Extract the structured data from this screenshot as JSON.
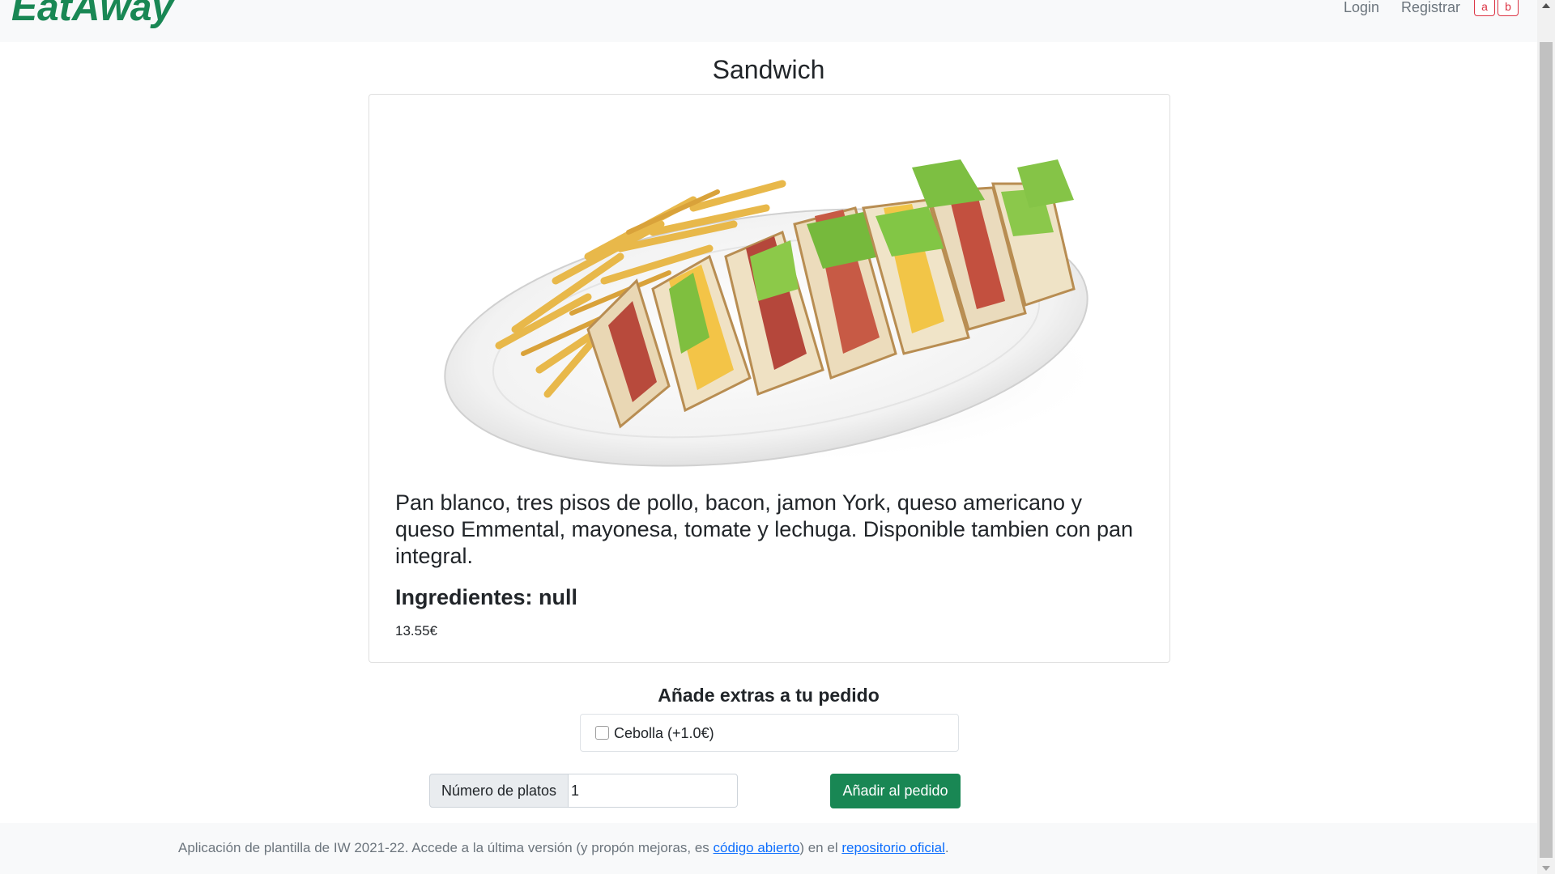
{
  "navbar": {
    "brand": "EatAway",
    "login": "Login",
    "register": "Registrar",
    "btn_a": "a",
    "btn_b": "b"
  },
  "product": {
    "title": "Sandwich",
    "description": "Pan blanco, tres pisos de pollo, bacon, jamon York, queso americano y queso Emmental, mayonesa, tomate y lechuga. Disponible tambien con pan integral.",
    "ingredients": "Ingredientes: null",
    "price": "13.55€"
  },
  "extras": {
    "title": "Añade extras a tu pedido",
    "items": [
      {
        "label": "Cebolla (+1.0€)",
        "checked": false
      }
    ]
  },
  "order": {
    "quantity_label": "Número de platos",
    "quantity_value": "1",
    "add_button": "Añadir al pedido"
  },
  "footer": {
    "text_before": "Aplicación de plantilla de IW 2021-22. Accede a la última versión (y propón mejoras, es ",
    "link1": "código abierto",
    "text_middle": ") en el ",
    "link2": "repositorio oficial",
    "text_after": "."
  },
  "colors": {
    "brand": "#198754",
    "primary_button": "#198754",
    "outline_danger": "#dc3545",
    "link": "#0d6efd"
  }
}
